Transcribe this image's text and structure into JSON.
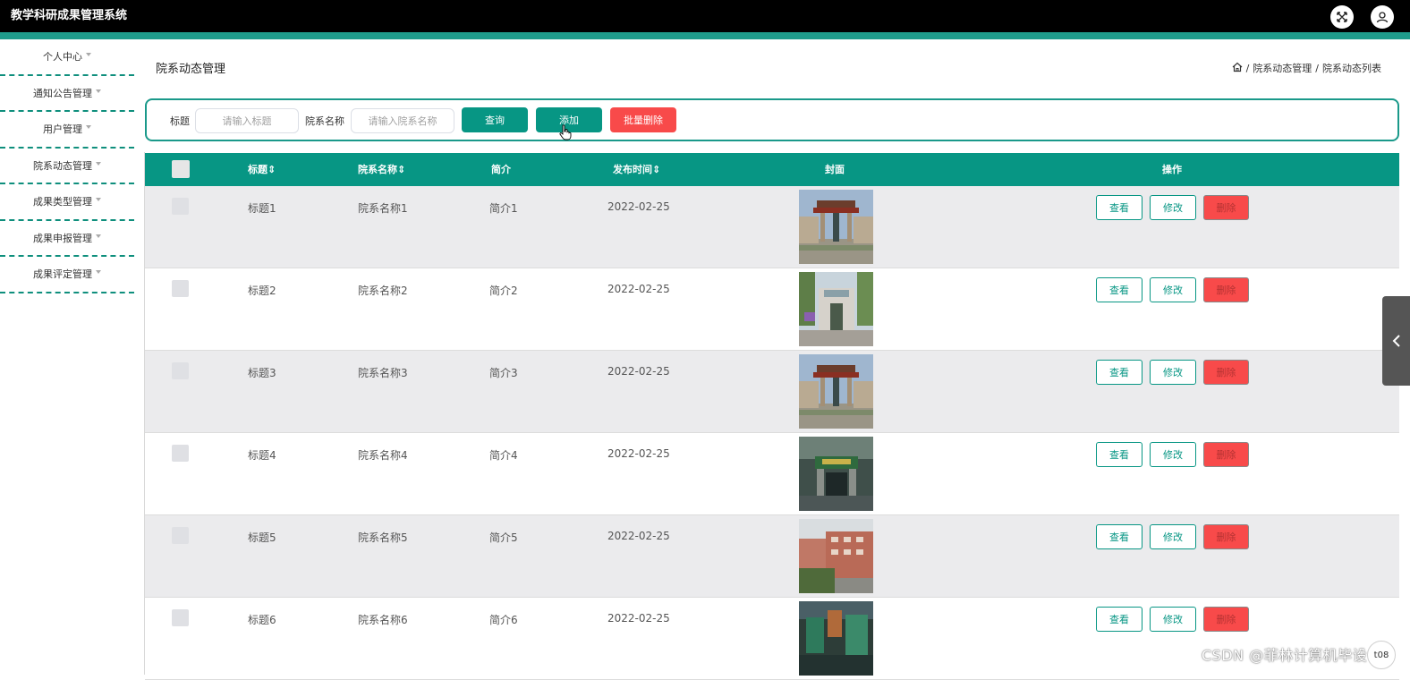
{
  "app": {
    "title": "教学科研成果管理系统"
  },
  "sidebar": {
    "items": [
      {
        "label": "个人中心"
      },
      {
        "label": "通知公告管理"
      },
      {
        "label": "用户管理"
      },
      {
        "label": "院系动态管理"
      },
      {
        "label": "成果类型管理"
      },
      {
        "label": "成果申报管理"
      },
      {
        "label": "成果评定管理"
      }
    ]
  },
  "page": {
    "title": "院系动态管理",
    "breadcrumb": [
      "院系动态管理",
      "院系动态列表"
    ]
  },
  "search": {
    "title_label": "标题",
    "title_placeholder": "请输入标题",
    "dept_label": "院系名称",
    "dept_placeholder": "请输入院系名称",
    "query_label": "查询",
    "add_label": "添加",
    "batch_delete_label": "批量删除"
  },
  "table": {
    "headers": [
      "标题",
      "院系名称",
      "简介",
      "发布时间",
      "封面",
      "操作"
    ],
    "sort_glyph": "⇕",
    "action_labels": {
      "view": "查看",
      "edit": "修改",
      "delete": "删除"
    },
    "rows": [
      {
        "title": "标题1",
        "dept": "院系名称1",
        "intro": "简介1",
        "date": "2022-02-25"
      },
      {
        "title": "标题2",
        "dept": "院系名称2",
        "intro": "简介2",
        "date": "2022-02-25"
      },
      {
        "title": "标题3",
        "dept": "院系名称3",
        "intro": "简介3",
        "date": "2022-02-25"
      },
      {
        "title": "标题4",
        "dept": "院系名称4",
        "intro": "简介4",
        "date": "2022-02-25"
      },
      {
        "title": "标题5",
        "dept": "院系名称5",
        "intro": "简介5",
        "date": "2022-02-25"
      },
      {
        "title": "标题6",
        "dept": "院系名称6",
        "intro": "简介6",
        "date": "2022-02-25"
      }
    ]
  },
  "overlay": {
    "watermark": "CSDN @菲林计算机毕设",
    "page_indicator": "t08"
  },
  "colors": {
    "topbar": "#000000",
    "accent": "#079684",
    "danger": "#f84a4a",
    "row_alt": "#ebebed"
  }
}
